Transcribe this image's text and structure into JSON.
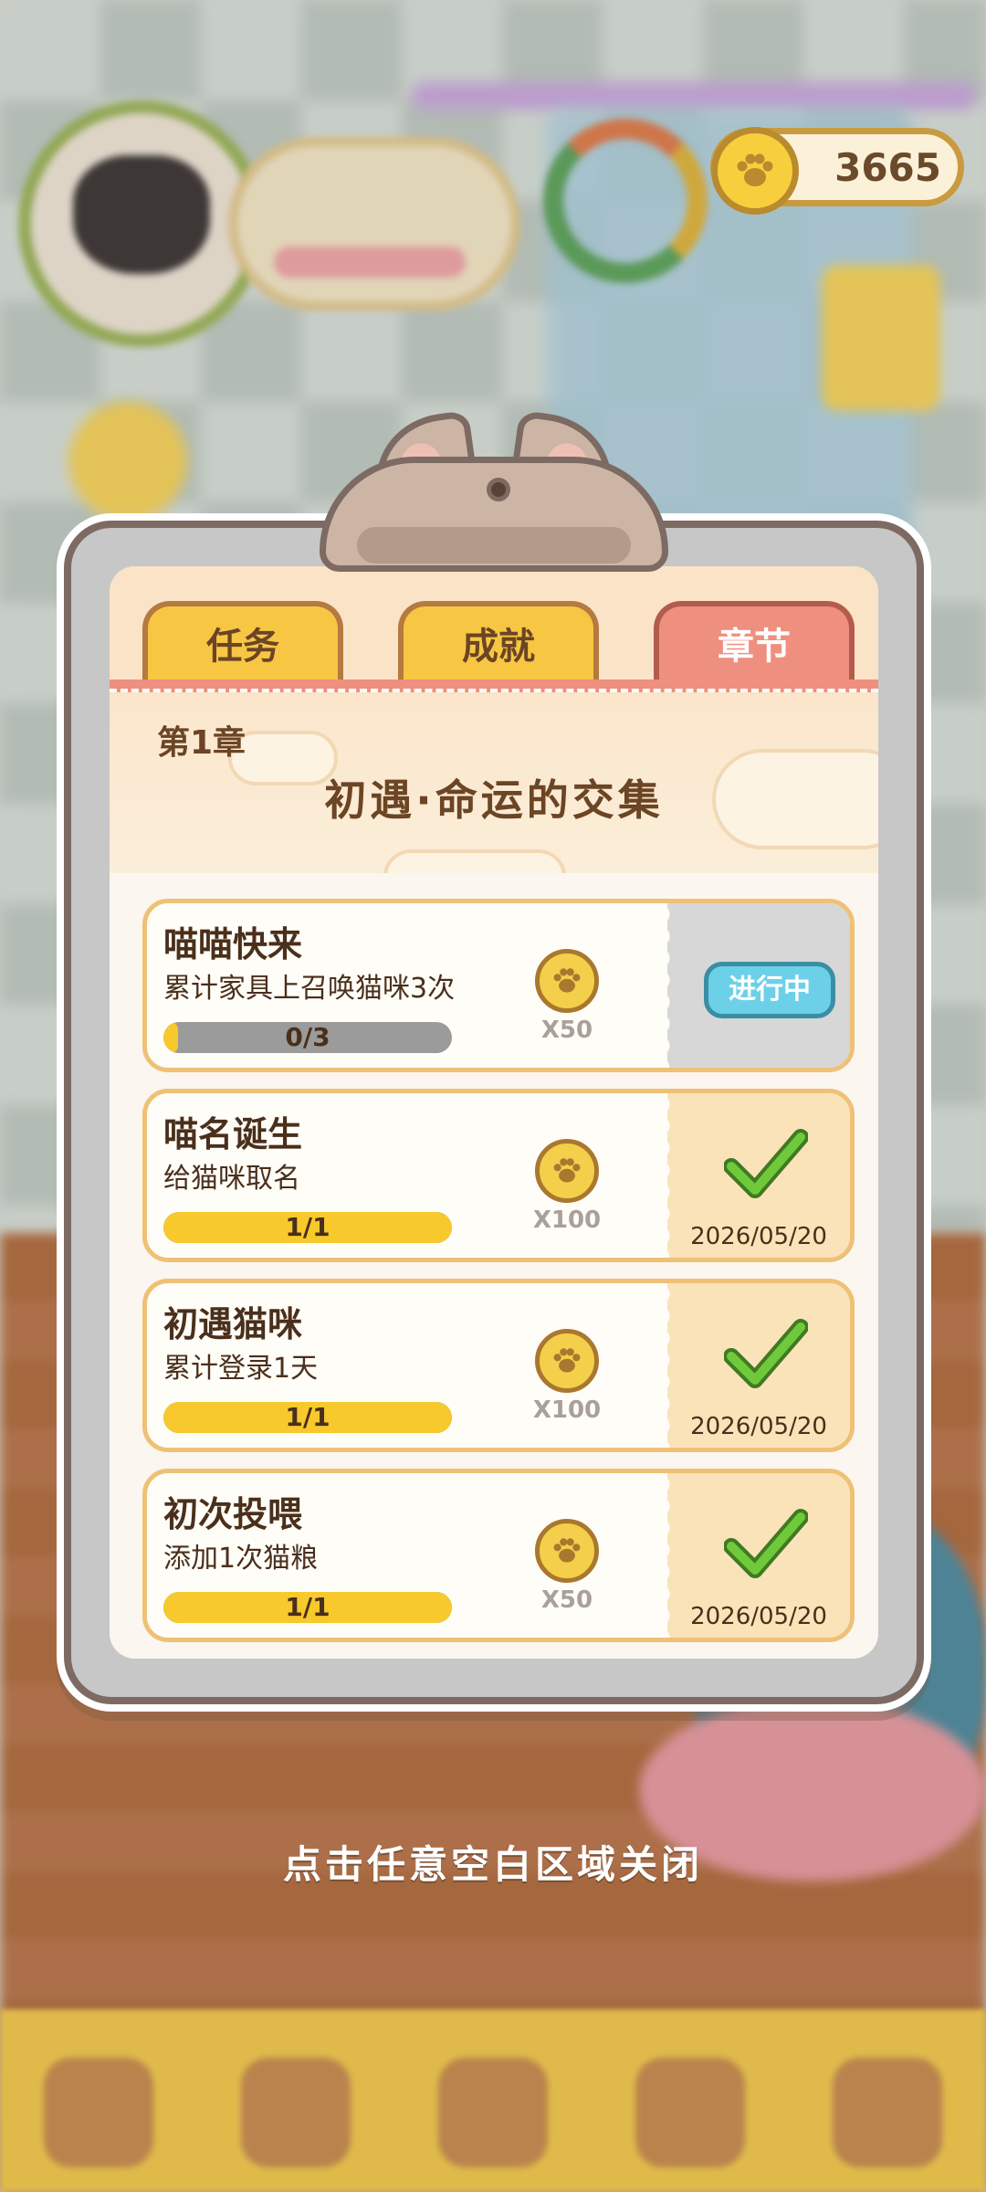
{
  "hud": {
    "coins": "3665"
  },
  "dialog": {
    "tabs": [
      {
        "label": "任务",
        "active": false
      },
      {
        "label": "成就",
        "active": false
      },
      {
        "label": "章节",
        "active": true
      }
    ],
    "chapter": {
      "number": "第1章",
      "title": "初遇·命运的交集"
    },
    "tasks": [
      {
        "name": "喵喵快来",
        "desc": "累计家具上召唤猫咪3次",
        "progress_text": "0/3",
        "progress": 0.05,
        "reward_qty": "X50",
        "status": "进行中",
        "date": ""
      },
      {
        "name": "喵名诞生",
        "desc": "给猫咪取名",
        "progress_text": "1/1",
        "progress": 1.0,
        "reward_qty": "X100",
        "status": "done",
        "date": "2026/05/20"
      },
      {
        "name": "初遇猫咪",
        "desc": "累计登录1天",
        "progress_text": "1/1",
        "progress": 1.0,
        "reward_qty": "X100",
        "status": "done",
        "date": "2026/05/20"
      },
      {
        "name": "初次投喂",
        "desc": "添加1次猫粮",
        "progress_text": "1/1",
        "progress": 1.0,
        "reward_qty": "X50",
        "status": "done",
        "date": "2026/05/20"
      }
    ]
  },
  "close_hint": "点击任意空白区域关闭",
  "colors": {
    "active_tab": "#ee8f80",
    "inactive_tab": "#f7c744",
    "progress_fill": "#f7c92c",
    "status_button": "#6cd0e9",
    "check": "#6fc93a"
  },
  "icons": {
    "coin": "paw-coin-icon",
    "check": "check-icon"
  }
}
